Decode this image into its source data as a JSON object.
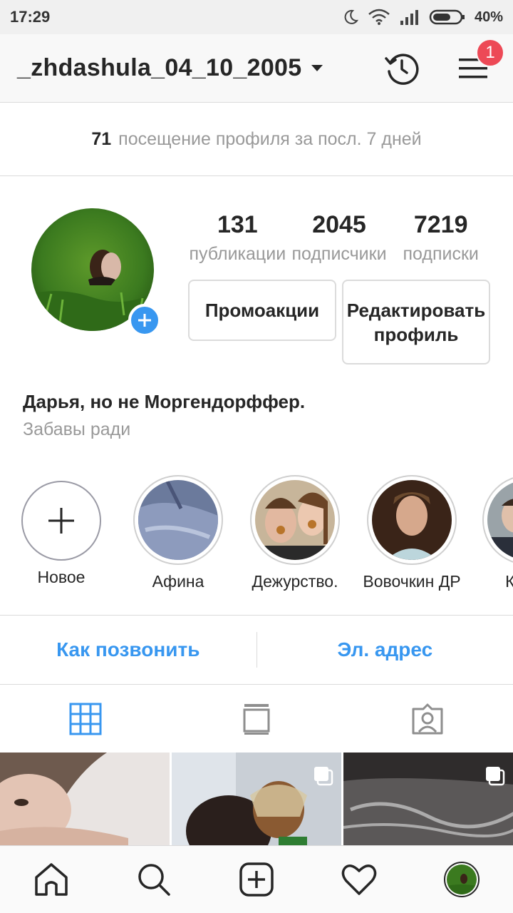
{
  "status_bar": {
    "time": "17:29",
    "battery": "40%",
    "icons": [
      "moon-icon",
      "wifi-icon",
      "signal-icon",
      "battery-icon"
    ]
  },
  "header": {
    "username": "_zhdashula_04_10_2005",
    "notification_count": "1",
    "icons": [
      "history-icon",
      "menu-icon",
      "chevron-down-icon"
    ]
  },
  "visits": {
    "count": "71",
    "text": "посещение профиля за посл. 7 дней"
  },
  "profile": {
    "stats": [
      {
        "value": "131",
        "label": "публикации"
      },
      {
        "value": "2045",
        "label": "подписчики"
      },
      {
        "value": "7219",
        "label": "подписки"
      }
    ],
    "promo_button": "Промоакции",
    "edit_button": "Редактировать профиль",
    "bio_name": "Дарья, но не Моргендорффер.",
    "bio_text": "Забавы ради"
  },
  "highlights": [
    {
      "label": "Новое"
    },
    {
      "label": "Афина"
    },
    {
      "label": "Дежурство."
    },
    {
      "label": "Вовочкин ДР"
    },
    {
      "label": "КОРЕ"
    }
  ],
  "contact": {
    "call": "Как позвонить",
    "email": "Эл. адрес"
  },
  "tabs": [
    "grid-icon",
    "feed-icon",
    "tagged-icon"
  ],
  "bottom_nav": [
    "home-icon",
    "search-icon",
    "add-post-icon",
    "heart-icon",
    "profile-avatar"
  ],
  "colors": {
    "accent": "#3897f0",
    "badge": "#ed4956",
    "text": "#262626",
    "muted": "#999999",
    "border": "#dbdbdb"
  }
}
